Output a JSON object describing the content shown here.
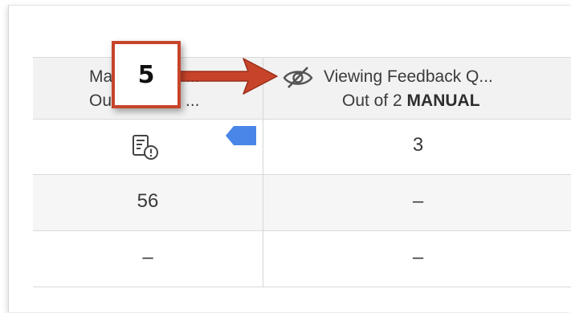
{
  "callout": {
    "number": "5"
  },
  "columns": [
    {
      "title": "Ma",
      "title_tail": "...",
      "subtitle": "Ou",
      "subtitle_tail": "..."
    },
    {
      "title": "Viewing Feedback Q...",
      "subtitle_prefix": "Out of 2 ",
      "subtitle_strong": "MANUAL"
    }
  ],
  "rows": [
    {
      "col1_icon": "feedback-document-icon",
      "col2": "3"
    },
    {
      "col1": "56",
      "col2": "–"
    },
    {
      "col1": "–",
      "col2": "–"
    }
  ],
  "icons": {
    "hidden_column": "eye-slash-icon",
    "flag": "blue-flag-icon"
  },
  "colors": {
    "accent_arrow": "#c7442a",
    "flag": "#4a86e8"
  }
}
